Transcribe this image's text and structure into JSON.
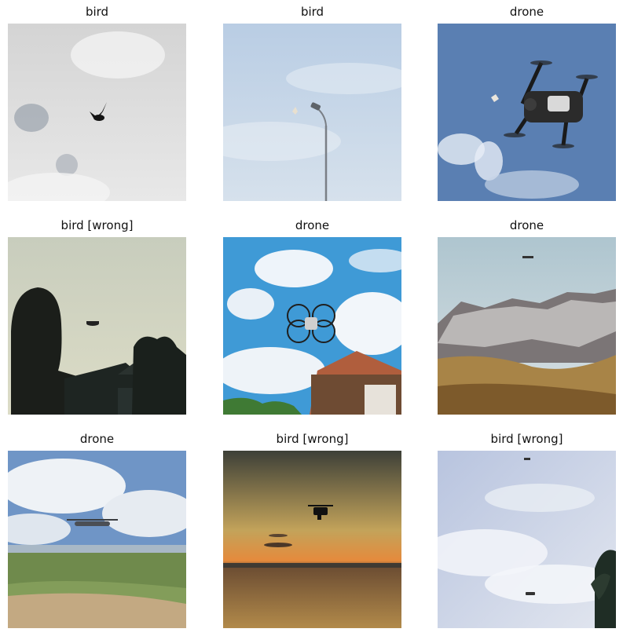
{
  "grid": {
    "cells": [
      {
        "title": "bird",
        "icon": "bird-in-cloudy-gray-sky"
      },
      {
        "title": "bird",
        "icon": "bird-near-street-lamp"
      },
      {
        "title": "drone",
        "icon": "quadcopter-close-up-blue-sky"
      },
      {
        "title": "bird [wrong]",
        "icon": "person-silhouette-watching-drone"
      },
      {
        "title": "drone",
        "icon": "caged-drone-over-roof"
      },
      {
        "title": "drone",
        "icon": "drone-over-mountains"
      },
      {
        "title": "drone",
        "icon": "drone-over-green-fields"
      },
      {
        "title": "bird [wrong]",
        "icon": "drone-at-sunset-sea"
      },
      {
        "title": "bird [wrong]",
        "icon": "drones-in-pale-sky"
      }
    ]
  }
}
